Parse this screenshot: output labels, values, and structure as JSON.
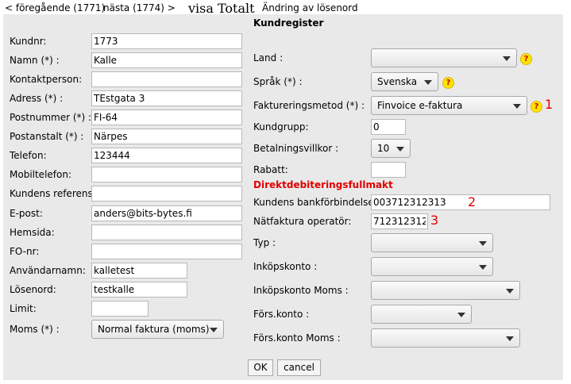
{
  "nav": {
    "prev": "< föregående (1771)",
    "next": "nästa (1774) >",
    "title": "visa Totalt",
    "password_change": "Ändring av lösenord"
  },
  "form_title": "Kundregister",
  "left": {
    "kundnr": {
      "label": "Kundnr:",
      "value": "1773"
    },
    "namn": {
      "label": "Namn (*) :",
      "value": "Kalle"
    },
    "kontaktperson": {
      "label": "Kontaktperson:",
      "value": ""
    },
    "adress": {
      "label": "Adress (*) :",
      "value": "TEstgata 3"
    },
    "postnummer": {
      "label": "Postnummer (*) :",
      "value": "FI-64"
    },
    "postanstalt": {
      "label": "Postanstalt (*) :",
      "value": "Närpes"
    },
    "telefon": {
      "label": "Telefon:",
      "value": "123444"
    },
    "mobiltelefon": {
      "label": "Mobiltelefon:",
      "value": ""
    },
    "referens": {
      "label": "Kundens referens:",
      "value": ""
    },
    "epost": {
      "label": "E-post:",
      "value": "anders@bits-bytes.fi"
    },
    "hemsida": {
      "label": "Hemsida:",
      "value": ""
    },
    "fonr": {
      "label": "FO-nr:",
      "value": ""
    },
    "anvandarnamn": {
      "label": "Användarnamn:",
      "value": "kalletest"
    },
    "losenord": {
      "label": "Lösenord:",
      "value": "testkalle"
    },
    "limit": {
      "label": "Limit:",
      "value": ""
    },
    "moms": {
      "label": "Moms (*) :",
      "value": "Normal faktura (moms)"
    }
  },
  "right": {
    "land": {
      "label": "Land :",
      "value": ""
    },
    "sprak": {
      "label": "Språk (*) :",
      "value": "Svenska"
    },
    "faktureringsmetod": {
      "label": "Faktureringsmetod (*) :",
      "value": "Finvoice e-faktura"
    },
    "kundgrupp": {
      "label": "Kundgrupp:",
      "value": "0"
    },
    "betalningsvillkor": {
      "label": "Betalningsvillkor :",
      "value": "10"
    },
    "rabatt": {
      "label": "Rabatt:",
      "value": ""
    },
    "direct_debit_heading": "Direktdebiteringsfullmakt",
    "bankforbindelse": {
      "label": "Kundens bankförbindelse:",
      "value": "003712312313"
    },
    "natfaktura": {
      "label": "Nätfaktura operatör:",
      "value": "7123123123"
    },
    "typ": {
      "label": "Typ :",
      "value": ""
    },
    "inkopskonto": {
      "label": "Inköpskonto :",
      "value": ""
    },
    "inkopskonto_moms": {
      "label": "Inköpskonto Moms :",
      "value": ""
    },
    "forskonto": {
      "label": "Förs.konto :",
      "value": ""
    },
    "forskonto_moms": {
      "label": "Förs.konto Moms :",
      "value": ""
    }
  },
  "annotations": {
    "one": "1",
    "two": "2",
    "three": "3"
  },
  "help_glyph": "?",
  "buttons": {
    "ok": "OK",
    "cancel": "cancel"
  },
  "colors": {
    "panel_bg": "#e9e9e9",
    "heading_red": "#e00000",
    "help_yellow": "#ffe400"
  }
}
